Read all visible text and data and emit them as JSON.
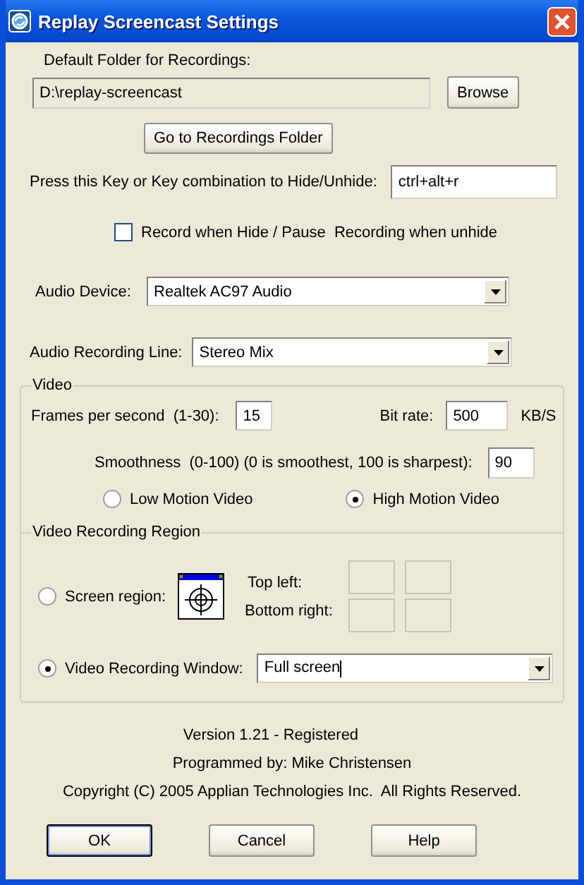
{
  "window": {
    "title": "Replay Screencast Settings"
  },
  "folder": {
    "label": "Default Folder for Recordings:",
    "value": "D:\\replay-screencast",
    "browse": "Browse",
    "goto": "Go to Recordings Folder"
  },
  "hotkey": {
    "label": "Press this Key or Key combination to Hide/Unhide:",
    "value": "ctrl+alt+r"
  },
  "record_when_hidden": {
    "label": "Record when Hide / Pause  Recording when unhide",
    "checked": false
  },
  "audio_device": {
    "label": "Audio Device:",
    "value": "Realtek AC97 Audio"
  },
  "audio_line": {
    "label": "Audio Recording Line:",
    "value": "Stereo Mix"
  },
  "video": {
    "legend": "Video",
    "fps": {
      "label": "Frames per second  (1-30):",
      "value": "15"
    },
    "bitrate": {
      "label": "Bit rate:",
      "value": "500",
      "unit": "KB/S"
    },
    "smoothness": {
      "label": "Smoothness  (0-100) (0 is smoothest, 100 is sharpest):",
      "value": "90"
    },
    "motion": [
      {
        "label": "Low Motion Video",
        "selected": false
      },
      {
        "label": "High Motion Video",
        "selected": true
      }
    ]
  },
  "region": {
    "legend": "Video Recording Region",
    "screen_region": {
      "label": "Screen region:",
      "selected": false,
      "top_left": "Top left:",
      "bottom_right": "Bottom right:"
    },
    "recording_window": {
      "label": "Video Recording Window:",
      "selected": true,
      "value": "Full screen"
    }
  },
  "about": [
    "Version 1.21 - Registered",
    "Programmed by: Mike Christensen",
    "Copyright (C) 2005 Applian Technologies Inc.  All Rights Reserved."
  ],
  "buttons": [
    {
      "label": "OK",
      "default": true
    },
    {
      "label": "Cancel",
      "default": false
    },
    {
      "label": "Help",
      "default": false
    }
  ]
}
